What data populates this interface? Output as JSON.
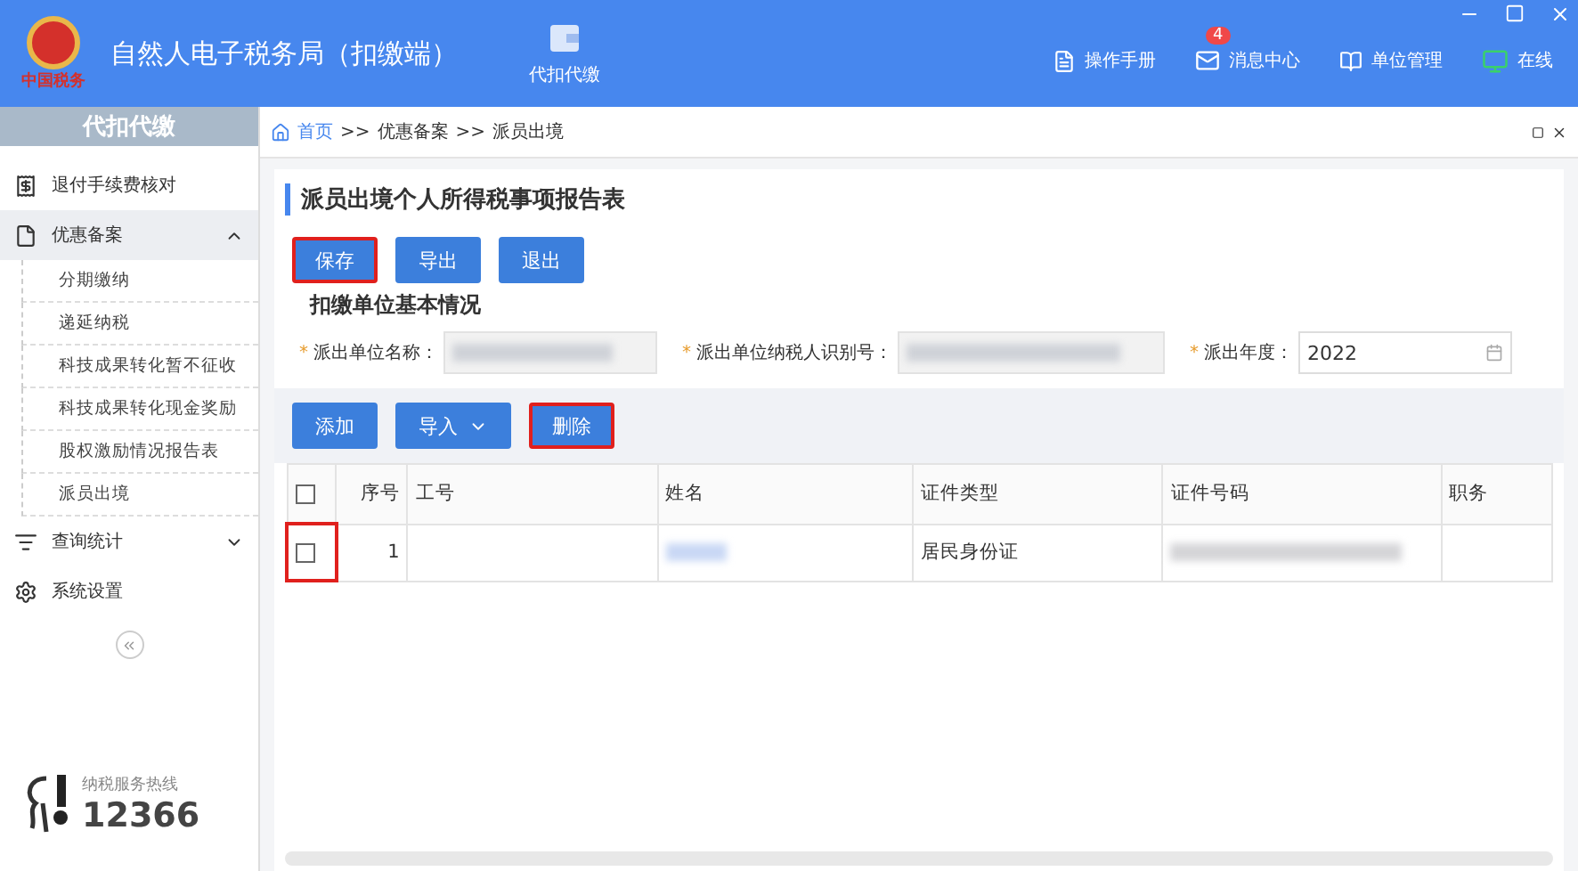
{
  "header": {
    "title": "自然人电子税务局（扣缴端）",
    "logo_text": "中国税务",
    "module": "代扣代缴",
    "links": [
      {
        "kind": "manual",
        "label": "操作手册"
      },
      {
        "kind": "message",
        "label": "消息中心",
        "badge": "4"
      },
      {
        "kind": "unit",
        "label": "单位管理"
      },
      {
        "kind": "online",
        "label": "在线"
      }
    ]
  },
  "sidebar": {
    "title": "代扣代缴",
    "items": [
      {
        "kind": "refund",
        "label": "退付手续费核对",
        "selected": false
      },
      {
        "kind": "doc",
        "label": "优惠备案",
        "expanded": true,
        "selected": true,
        "children": [
          {
            "label": "分期缴纳",
            "selected": false
          },
          {
            "label": "递延纳税",
            "selected": false
          },
          {
            "label": "科技成果转化暂不征收",
            "selected": false
          },
          {
            "label": "科技成果转化现金奖励",
            "selected": false
          },
          {
            "label": "股权激励情况报告表",
            "selected": false
          },
          {
            "label": "派员出境",
            "selected": false
          }
        ]
      },
      {
        "kind": "query",
        "label": "查询统计",
        "expanded": false,
        "selected": false
      },
      {
        "kind": "settings",
        "label": "系统设置",
        "selected": false
      }
    ],
    "hotline_label": "纳税服务热线",
    "hotline": "12366"
  },
  "breadcrumb": [
    "首页",
    "优惠备案",
    "派员出境"
  ],
  "breadcrumb_sep": ">>",
  "form": {
    "title": "派员出境个人所得税事项报告表",
    "buttons": [
      {
        "label": "保存",
        "highlighted": true
      },
      {
        "label": "导出",
        "highlighted": false
      },
      {
        "label": "退出",
        "highlighted": false
      }
    ],
    "section": "扣缴单位基本情况",
    "fields": [
      {
        "required_mark": "*",
        "label": "派出单位名称：",
        "redacted": true
      },
      {
        "required_mark": "*",
        "label": "派出单位纳税人识别号：",
        "redacted": true
      },
      {
        "required_mark": "*",
        "label": "派出年度：",
        "value": "2022",
        "redacted": false
      }
    ],
    "table_buttons": [
      {
        "label": "添加",
        "dropdown": false,
        "highlighted": false
      },
      {
        "label": "导入",
        "dropdown": true,
        "highlighted": false
      },
      {
        "label": "删除",
        "dropdown": false,
        "highlighted": true
      }
    ]
  },
  "table": {
    "columns": [
      "序号",
      "工号",
      "姓名",
      "证件类型",
      "证件号码",
      "职务"
    ],
    "header_checked": false,
    "rows": [
      {
        "checked": false,
        "highlighted": true,
        "cells": [
          "1",
          "",
          "",
          "居民身份证",
          "",
          ""
        ],
        "redacted": [
          false,
          false,
          true,
          false,
          true,
          false
        ]
      }
    ]
  }
}
